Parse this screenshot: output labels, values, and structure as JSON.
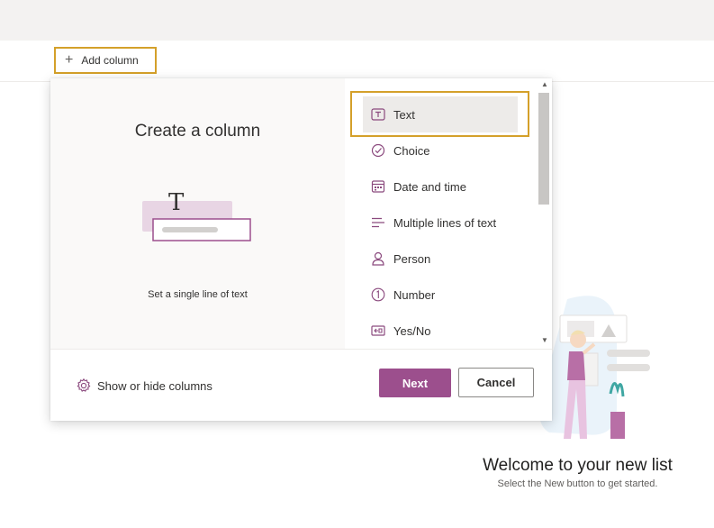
{
  "command_bar": {
    "add_column_label": "Add column"
  },
  "panel": {
    "title": "Create a column",
    "illustration_glyph": "T",
    "description": "Set a single line of text",
    "column_types": [
      {
        "label": "Text",
        "icon": "text-box-icon",
        "selected": true
      },
      {
        "label": "Choice",
        "icon": "check-circle-icon"
      },
      {
        "label": "Date and time",
        "icon": "calendar-icon"
      },
      {
        "label": "Multiple lines of text",
        "icon": "multiline-text-icon"
      },
      {
        "label": "Person",
        "icon": "person-icon"
      },
      {
        "label": "Number",
        "icon": "number-circle-icon"
      },
      {
        "label": "Yes/No",
        "icon": "toggle-icon"
      }
    ],
    "footer": {
      "show_hide_label": "Show or hide columns",
      "next_label": "Next",
      "cancel_label": "Cancel"
    }
  },
  "welcome": {
    "title": "Welcome to your new list",
    "subtitle": "Select the New button to get started."
  },
  "colors": {
    "accent": "#9c4f8d",
    "highlight_frame": "#d4a02a",
    "icon": "#8b4a7e"
  }
}
